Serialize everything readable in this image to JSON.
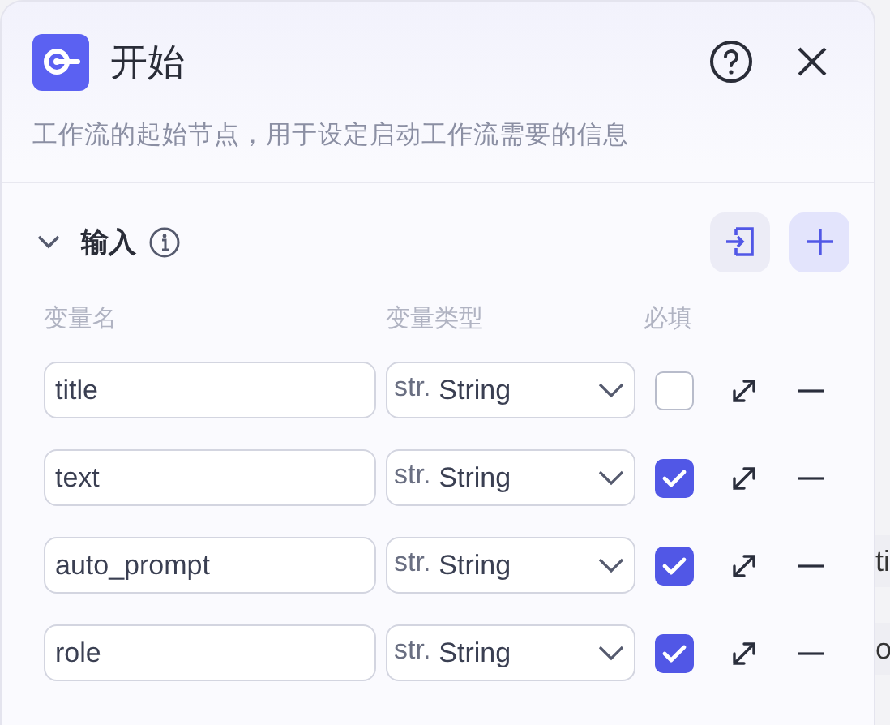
{
  "panel": {
    "title": "开始",
    "description": "工作流的起始节点，用于设定启动工作流需要的信息"
  },
  "section": {
    "title": "输入",
    "expanded": true
  },
  "columns": [
    "变量名",
    "变量类型",
    "必填"
  ],
  "variables": [
    {
      "name": "title",
      "type_prefix": "str.",
      "type": "String",
      "required": false
    },
    {
      "name": "text",
      "type_prefix": "str.",
      "type": "String",
      "required": true
    },
    {
      "name": "auto_prompt",
      "type_prefix": "str.",
      "type": "String",
      "required": true
    },
    {
      "name": "role",
      "type_prefix": "str.",
      "type": "String",
      "required": true
    }
  ],
  "background_fragments": [
    "ti",
    "o"
  ]
}
